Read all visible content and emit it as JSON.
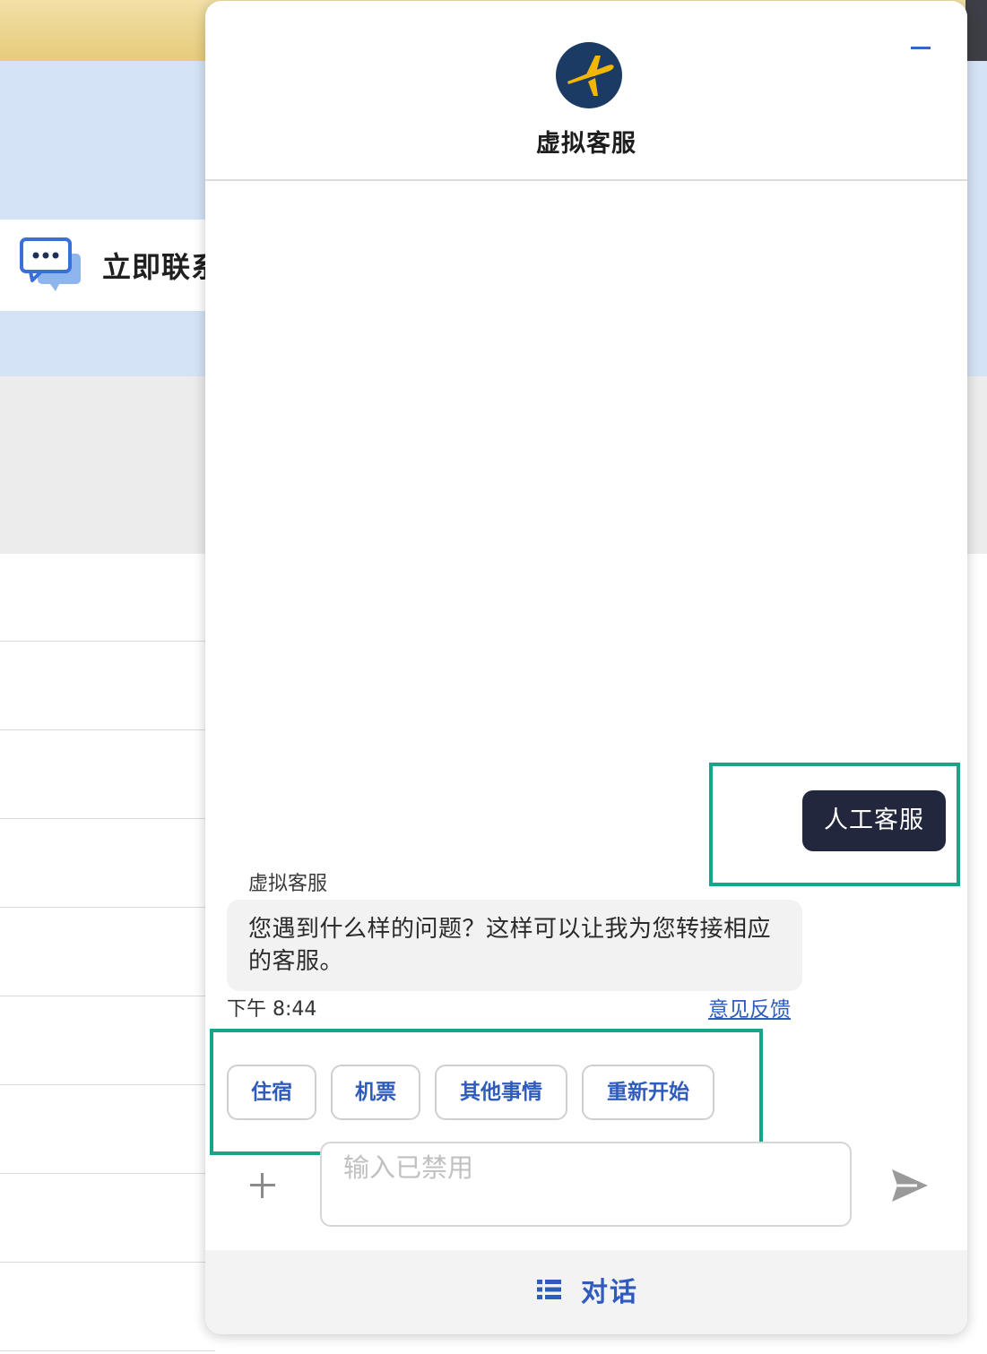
{
  "background": {
    "contact_label": "立即联系"
  },
  "chat": {
    "title": "虚拟客服",
    "logo_icon": "plane-logo-icon",
    "minimize_icon": "minimize-icon",
    "user_message": "人工客服",
    "bot": {
      "name": "虚拟客服",
      "message": "您遇到什么样的问题？这样可以让我为您转接相应的客服。",
      "time": "下午 8:44",
      "feedback_link": "意见反馈"
    },
    "quick_replies": [
      {
        "label": "住宿"
      },
      {
        "label": "机票"
      },
      {
        "label": "其他事情"
      },
      {
        "label": "重新开始"
      }
    ],
    "input": {
      "placeholder": "输入已禁用"
    },
    "footer": {
      "tab_label": "对话",
      "tab_icon": "list-icon"
    }
  },
  "colors": {
    "brand_navy": "#1b3a64",
    "brand_yellow": "#f2b705",
    "accent_blue": "#2f5bbd",
    "user_bubble": "#22273d",
    "highlight": "#17a589"
  }
}
